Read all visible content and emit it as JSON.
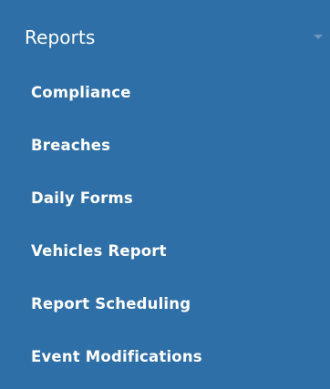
{
  "menu": {
    "title": "Reports",
    "chevron_icon": "chevron-down-icon",
    "items": [
      {
        "label": "Compliance"
      },
      {
        "label": "Breaches"
      },
      {
        "label": "Daily Forms"
      },
      {
        "label": "Vehicles Report"
      },
      {
        "label": "Report Scheduling"
      },
      {
        "label": "Event Modifications"
      }
    ]
  },
  "colors": {
    "background": "#2f6fa8",
    "text": "#ffffff",
    "chevron": "#6d98c1"
  }
}
